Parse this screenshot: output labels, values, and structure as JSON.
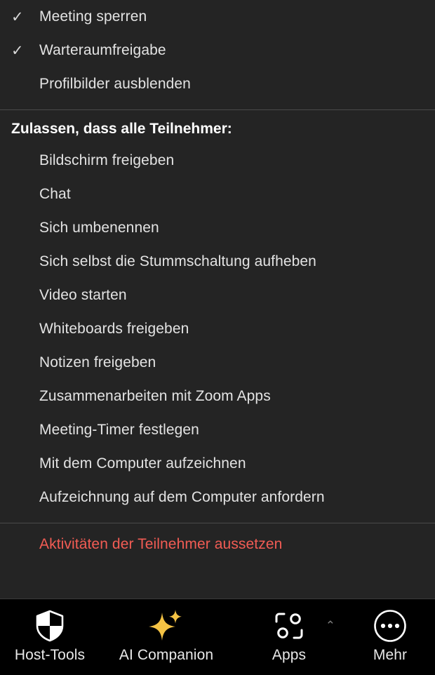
{
  "menu": {
    "top_items": [
      {
        "label": "Meeting sperren",
        "checked": true
      },
      {
        "label": "Warteraumfreigabe",
        "checked": true
      },
      {
        "label": "Profilbilder ausblenden",
        "checked": false
      }
    ],
    "section_title": "Zulassen, dass alle Teilnehmer:",
    "allow_items": [
      {
        "label": "Bildschirm freigeben"
      },
      {
        "label": "Chat"
      },
      {
        "label": "Sich umbenennen"
      },
      {
        "label": "Sich selbst die Stummschaltung aufheben"
      },
      {
        "label": "Video starten"
      },
      {
        "label": "Whiteboards freigeben"
      },
      {
        "label": "Notizen freigeben"
      },
      {
        "label": "Zusammenarbeiten mit Zoom Apps"
      },
      {
        "label": "Meeting-Timer festlegen"
      },
      {
        "label": "Mit dem Computer aufzeichnen"
      },
      {
        "label": "Aufzeichnung auf dem Computer anfordern"
      }
    ],
    "danger_item": {
      "label": "Aktivitäten der Teilnehmer aussetzen",
      "color": "#f25c54"
    },
    "check_glyph": "✓"
  },
  "toolbar": {
    "items": [
      {
        "label": "Host-Tools",
        "icon": "shield-check-icon"
      },
      {
        "label": "AI Companion",
        "icon": "sparkles-icon",
        "icon_color": "#f5c344"
      },
      {
        "label": "Apps",
        "icon": "apps-icon",
        "caret": "⌃"
      },
      {
        "label": "Mehr",
        "icon": "ellipsis-circle-icon"
      }
    ]
  },
  "colors": {
    "menu_background": "#242424",
    "toolbar_background": "#000000",
    "divider": "#4a4a4a",
    "text": "#e3e3e3",
    "title": "#ffffff",
    "danger": "#f25c54",
    "accent_gold": "#f5c344"
  }
}
